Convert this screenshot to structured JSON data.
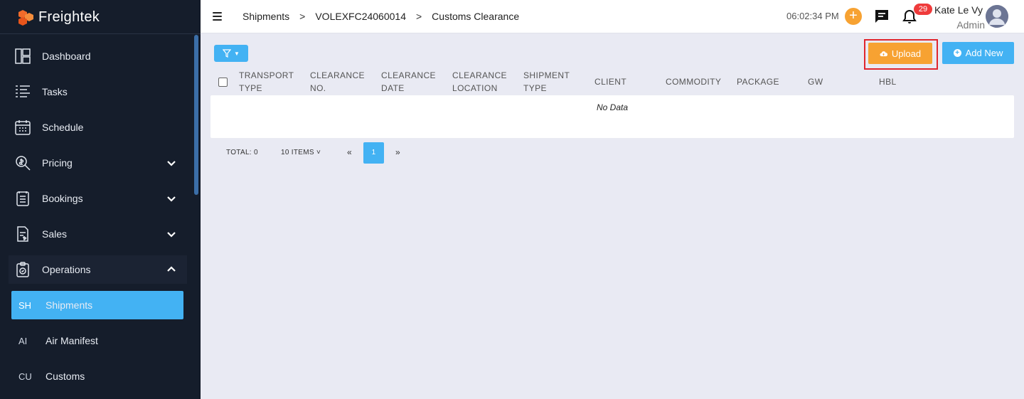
{
  "app": {
    "brand": "Freightek"
  },
  "sidebar": {
    "items": [
      {
        "label": "Dashboard",
        "icon": "dashboard-icon"
      },
      {
        "label": "Tasks",
        "icon": "tasks-icon"
      },
      {
        "label": "Schedule",
        "icon": "calendar-icon"
      },
      {
        "label": "Pricing",
        "icon": "pricing-icon",
        "expandable": true
      },
      {
        "label": "Bookings",
        "icon": "bookings-icon",
        "expandable": true
      },
      {
        "label": "Sales",
        "icon": "sales-icon",
        "expandable": true
      },
      {
        "label": "Operations",
        "icon": "operations-icon",
        "expandable": true,
        "expanded": true
      }
    ],
    "sub_items": [
      {
        "abbr": "SH",
        "label": "Shipments",
        "active": true
      },
      {
        "abbr": "AI",
        "label": "Air Manifest"
      },
      {
        "abbr": "CU",
        "label": "Customs"
      }
    ]
  },
  "header": {
    "breadcrumb": [
      "Shipments",
      "VOLEXFC24060014",
      "Customs Clearance"
    ],
    "separator": ">",
    "clock": "06:02:34 PM",
    "notification_count": "29",
    "user_name": "Kate Le Vy",
    "user_role": "Admin"
  },
  "toolbar": {
    "upload_label": "Upload",
    "add_new_label": "Add New"
  },
  "table": {
    "columns": [
      "TRANSPORT TYPE",
      "CLEARANCE NO.",
      "CLEARANCE DATE",
      "CLEARANCE LOCATION",
      "SHIPMENT TYPE",
      "CLIENT",
      "COMMODITY",
      "PACKAGE",
      "GW",
      "HBL"
    ],
    "empty_text": "No Data"
  },
  "pagination": {
    "total_label": "TOTAL: 0",
    "per_page_label": "10 ITEMS",
    "current_page": "1",
    "prev": "«",
    "next": "»"
  },
  "colors": {
    "sidebar_bg": "#151d2b",
    "accent_blue": "#43b2f3",
    "accent_orange": "#f7a232",
    "highlight_red": "#e0262e",
    "content_bg": "#e9eaf3"
  }
}
